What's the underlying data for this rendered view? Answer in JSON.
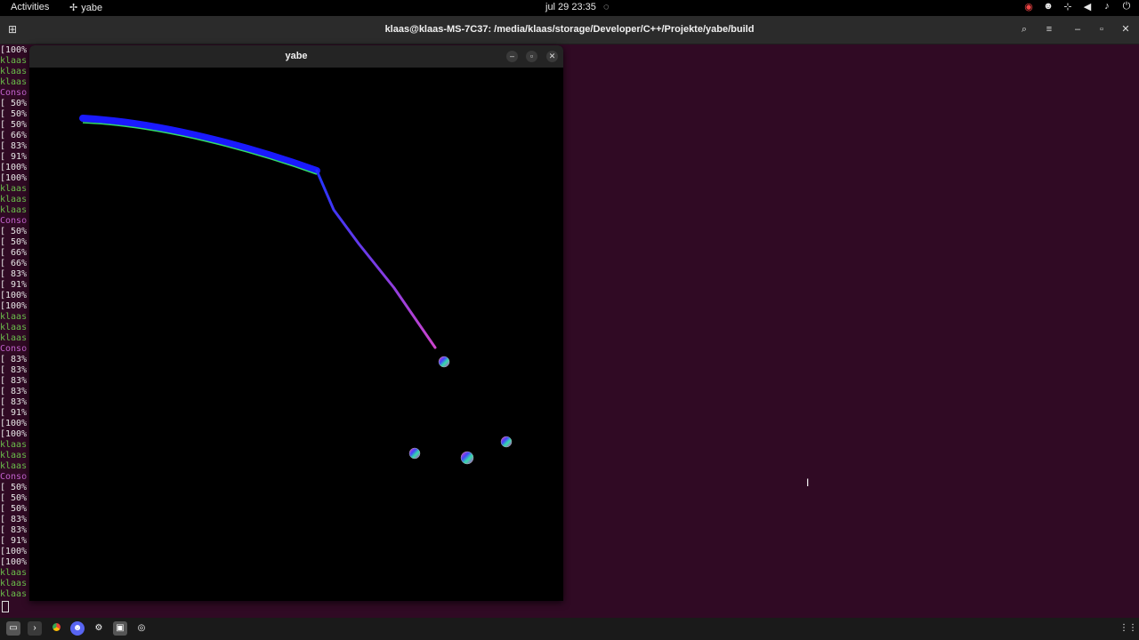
{
  "topbar": {
    "activities": "Activities",
    "app_name": "yabe",
    "clock": "jul 29  23:35"
  },
  "terminal": {
    "title": "klaas@klaas-MS-7C37: /media/klaas/storage/Developer/C++/Projekte/yabe/build",
    "lines": [
      {
        "t": "[100%",
        "c": "white"
      },
      {
        "t": "klaas",
        "c": "green"
      },
      {
        "t": "klaas",
        "c": "green"
      },
      {
        "t": "klaas",
        "c": "green"
      },
      {
        "t": "Conso",
        "c": "purple"
      },
      {
        "t": "[ 50%",
        "c": "white"
      },
      {
        "t": "[ 50%",
        "c": "white"
      },
      {
        "t": "[ 50%",
        "c": "white"
      },
      {
        "t": "[ 66%",
        "c": "white"
      },
      {
        "t": "[ 83%",
        "c": "white"
      },
      {
        "t": "[ 91%",
        "c": "white"
      },
      {
        "t": "[100%",
        "c": "white"
      },
      {
        "t": "[100%",
        "c": "white"
      },
      {
        "t": "klaas",
        "c": "green"
      },
      {
        "t": "klaas",
        "c": "green"
      },
      {
        "t": "klaas",
        "c": "green"
      },
      {
        "t": "Conso",
        "c": "purple"
      },
      {
        "t": "[ 50%",
        "c": "white"
      },
      {
        "t": "[ 50%",
        "c": "white"
      },
      {
        "t": "[ 66%",
        "c": "white"
      },
      {
        "t": "[ 66%",
        "c": "white"
      },
      {
        "t": "[ 83%",
        "c": "white"
      },
      {
        "t": "[ 91%",
        "c": "white"
      },
      {
        "t": "[100%",
        "c": "white"
      },
      {
        "t": "[100%",
        "c": "white"
      },
      {
        "t": "klaas",
        "c": "green"
      },
      {
        "t": "klaas",
        "c": "green"
      },
      {
        "t": "klaas",
        "c": "green"
      },
      {
        "t": "Conso",
        "c": "purple"
      },
      {
        "t": "[ 83%",
        "c": "white"
      },
      {
        "t": "[ 83%",
        "c": "white"
      },
      {
        "t": "[ 83%",
        "c": "white"
      },
      {
        "t": "[ 83%",
        "c": "white"
      },
      {
        "t": "[ 83%",
        "c": "white"
      },
      {
        "t": "[ 91%",
        "c": "white"
      },
      {
        "t": "[100%",
        "c": "white"
      },
      {
        "t": "[100%",
        "c": "white"
      },
      {
        "t": "klaas",
        "c": "green"
      },
      {
        "t": "klaas",
        "c": "green"
      },
      {
        "t": "klaas",
        "c": "green"
      },
      {
        "t": "Conso",
        "c": "purple"
      },
      {
        "t": "[ 50%",
        "c": "white"
      },
      {
        "t": "[ 50%",
        "c": "white"
      },
      {
        "t": "[ 50%",
        "c": "white"
      },
      {
        "t": "[ 83%",
        "c": "white"
      },
      {
        "t": "[ 83%",
        "c": "white"
      },
      {
        "t": "[ 91%",
        "c": "white"
      },
      {
        "t": "[100%",
        "c": "white"
      },
      {
        "t": "[100%",
        "c": "white"
      },
      {
        "t": "klaas",
        "c": "green"
      },
      {
        "t": "klaas",
        "c": "green"
      },
      {
        "t": "klaas",
        "c": "green"
      }
    ]
  },
  "yabe_window": {
    "title": "yabe"
  },
  "colors": {
    "terminal_bg": "#300a24",
    "rope_blue": "#1a1aff",
    "rope_green": "#33dd66",
    "rope_purple": "#cc33cc"
  }
}
